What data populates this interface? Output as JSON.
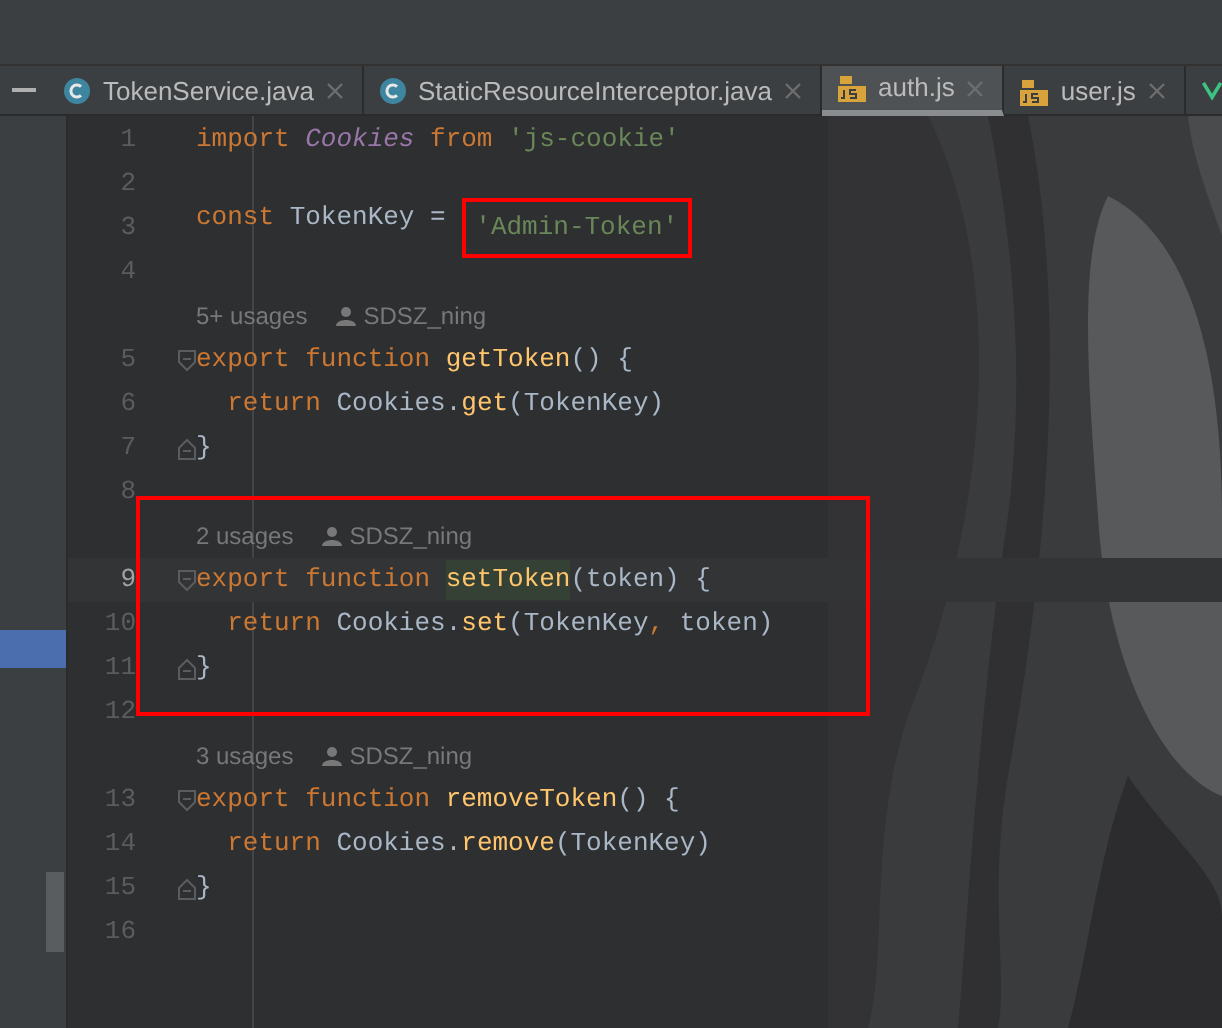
{
  "tabs": [
    {
      "label": "TokenService.java",
      "kind": "java",
      "selected": false
    },
    {
      "label": "StaticResourceInterceptor.java",
      "kind": "java",
      "selected": false
    },
    {
      "label": "auth.js",
      "kind": "js",
      "selected": true
    },
    {
      "label": "user.js",
      "kind": "js",
      "selected": false
    }
  ],
  "editor": {
    "lines": [
      {
        "kind": "code",
        "number": "1",
        "current": false,
        "fold_start": false,
        "fold_end": false,
        "tokens": [
          {
            "kind": "keyword",
            "text": "import "
          },
          {
            "kind": "class",
            "text": "Cookies"
          },
          {
            "kind": "keyword",
            "text": " from "
          },
          {
            "kind": "string",
            "text": "'js-cookie'"
          }
        ]
      },
      {
        "kind": "code",
        "number": "2",
        "current": false,
        "fold_start": false,
        "fold_end": false
      },
      {
        "kind": "code",
        "number": "3",
        "current": false,
        "fold_start": false,
        "fold_end": false,
        "tokens": [
          {
            "kind": "keyword",
            "text": "const "
          },
          {
            "kind": "plain",
            "text": "TokenKey = "
          },
          {
            "kind": "string",
            "text": "'Admin-Token'",
            "boxed": true
          }
        ]
      },
      {
        "kind": "code",
        "number": "4",
        "current": false,
        "fold_start": false,
        "fold_end": false
      },
      {
        "kind": "usages",
        "usages": "5+ usages",
        "author": "SDSZ_ning"
      },
      {
        "kind": "code",
        "number": "5",
        "current": false,
        "fold_start": true,
        "fold_end": false,
        "tokens": [
          {
            "kind": "keyword",
            "text": "export function "
          },
          {
            "kind": "function",
            "text": "getToken"
          },
          {
            "kind": "plain",
            "text": "() {"
          }
        ]
      },
      {
        "kind": "code",
        "number": "6",
        "current": false,
        "fold_start": false,
        "fold_end": false,
        "tokens": [
          {
            "kind": "keyword",
            "text": "  return "
          },
          {
            "kind": "plain",
            "text": "Cookies."
          },
          {
            "kind": "function",
            "text": "get"
          },
          {
            "kind": "plain",
            "text": "(TokenKey)"
          }
        ]
      },
      {
        "kind": "code",
        "number": "7",
        "current": false,
        "fold_start": false,
        "fold_end": true,
        "tokens": [
          {
            "kind": "plain",
            "text": "}"
          }
        ]
      },
      {
        "kind": "code",
        "number": "8",
        "current": false,
        "fold_start": false,
        "fold_end": false
      },
      {
        "kind": "usages",
        "usages": "2 usages",
        "author": "SDSZ_ning"
      },
      {
        "kind": "code",
        "number": "9",
        "current": true,
        "fold_start": true,
        "fold_end": false,
        "tokens": [
          {
            "kind": "keyword",
            "text": "export function "
          },
          {
            "kind": "function",
            "text": "setToken",
            "highlighted": true
          },
          {
            "kind": "plain",
            "text": "(token) {"
          }
        ]
      },
      {
        "kind": "code",
        "number": "10",
        "current": false,
        "fold_start": false,
        "fold_end": false,
        "tokens": [
          {
            "kind": "keyword",
            "text": "  return "
          },
          {
            "kind": "plain",
            "text": "Cookies."
          },
          {
            "kind": "function",
            "text": "set"
          },
          {
            "kind": "plain",
            "text": "(TokenKey"
          },
          {
            "kind": "keyword",
            "text": ", "
          },
          {
            "kind": "plain",
            "text": "token)"
          }
        ]
      },
      {
        "kind": "code",
        "number": "11",
        "current": false,
        "fold_start": false,
        "fold_end": true,
        "tokens": [
          {
            "kind": "plain",
            "text": "}"
          }
        ]
      },
      {
        "kind": "code",
        "number": "12",
        "current": false,
        "fold_start": false,
        "fold_end": false
      },
      {
        "kind": "usages",
        "usages": "3 usages",
        "author": "SDSZ_ning"
      },
      {
        "kind": "code",
        "number": "13",
        "current": false,
        "fold_start": true,
        "fold_end": false,
        "tokens": [
          {
            "kind": "keyword",
            "text": "export function "
          },
          {
            "kind": "function",
            "text": "removeToken"
          },
          {
            "kind": "plain",
            "text": "() {"
          }
        ]
      },
      {
        "kind": "code",
        "number": "14",
        "current": false,
        "fold_start": false,
        "fold_end": false,
        "tokens": [
          {
            "kind": "keyword",
            "text": "  return "
          },
          {
            "kind": "plain",
            "text": "Cookies."
          },
          {
            "kind": "function",
            "text": "remove"
          },
          {
            "kind": "plain",
            "text": "(TokenKey)"
          }
        ]
      },
      {
        "kind": "code",
        "number": "15",
        "current": false,
        "fold_start": false,
        "fold_end": true,
        "tokens": [
          {
            "kind": "plain",
            "text": "}"
          }
        ]
      },
      {
        "kind": "code",
        "number": "16",
        "current": false,
        "fold_start": false,
        "fold_end": false
      }
    ]
  }
}
